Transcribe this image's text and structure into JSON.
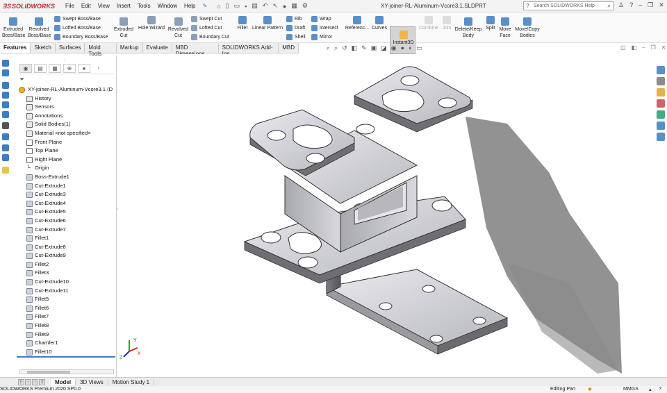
{
  "app": {
    "brand": "SOLIDWORKS",
    "filename": "XY-joiner-RL-Aluminum-Vcore3.1.SLDPRT"
  },
  "menus": [
    "File",
    "Edit",
    "View",
    "Insert",
    "Tools",
    "Window",
    "Help"
  ],
  "search": {
    "placeholder": "Search SOLIDWORKS Help"
  },
  "ribbon": {
    "extruded_boss": "Extruded\nBoss/Base",
    "revolved_boss": "Revolved\nBoss/Base",
    "swept_boss": "Swept Boss/Base",
    "lofted_boss": "Lofted Boss/Base",
    "boundary_boss": "Boundary Boss/Base",
    "extruded_cut": "Extruded\nCut",
    "hole_wizard": "Hole Wizard",
    "revolved_cut": "Revolved\nCut",
    "swept_cut": "Swept Cut",
    "lofted_cut": "Lofted Cut",
    "boundary_cut": "Boundary Cut",
    "fillet": "Fillet",
    "linear_pattern": "Linear Pattern",
    "rib": "Rib",
    "draft": "Draft",
    "shell": "Shell",
    "wrap": "Wrap",
    "intersect": "Intersect",
    "mirror": "Mirror",
    "reference": "Referenc...",
    "curves": "Curves",
    "instant3d": "Instant3D",
    "combine": "Combine",
    "join": "Join",
    "delete_keep": "Delete/Keep\nBody",
    "split": "Split",
    "move_face": "Move\nFace",
    "move_copy": "Move/Copy\nBodies"
  },
  "command_tabs": [
    "Features",
    "Sketch",
    "Surfaces",
    "Mold Tools",
    "Markup",
    "Evaluate",
    "MBD Dimensions",
    "SOLIDWORKS Add-Ins",
    "MBD"
  ],
  "tree": [
    {
      "label": "XY-joiner-RL-Aluminum-Vcore3.1  (D",
      "icon": "part",
      "exp": false,
      "indent": 0
    },
    {
      "label": "History",
      "icon": "folder",
      "exp": true,
      "indent": 1
    },
    {
      "label": "Sensors",
      "icon": "folder",
      "exp": false,
      "indent": 1
    },
    {
      "label": "Annotations",
      "icon": "folder",
      "exp": true,
      "indent": 1
    },
    {
      "label": "Solid Bodies(1)",
      "icon": "folder",
      "exp": true,
      "indent": 1
    },
    {
      "label": "Material <not specified>",
      "icon": "folder",
      "exp": false,
      "indent": 1
    },
    {
      "label": "Front Plane",
      "icon": "plane",
      "exp": false,
      "indent": 1
    },
    {
      "label": "Top Plane",
      "icon": "plane",
      "exp": false,
      "indent": 1
    },
    {
      "label": "Right Plane",
      "icon": "plane",
      "exp": false,
      "indent": 1
    },
    {
      "label": "Origin",
      "icon": "origin",
      "exp": false,
      "indent": 1
    },
    {
      "label": "Boss-Extrude1",
      "icon": "feat",
      "exp": true,
      "indent": 1
    },
    {
      "label": "Cut-Extrude1",
      "icon": "feat",
      "exp": true,
      "indent": 1
    },
    {
      "label": "Cut-Extrude3",
      "icon": "feat",
      "exp": true,
      "indent": 1
    },
    {
      "label": "Cut-Extrude4",
      "icon": "feat",
      "exp": true,
      "indent": 1
    },
    {
      "label": "Cut-Extrude5",
      "icon": "feat",
      "exp": true,
      "indent": 1
    },
    {
      "label": "Cut-Extrude6",
      "icon": "feat",
      "exp": true,
      "indent": 1
    },
    {
      "label": "Cut-Extrude7",
      "icon": "feat",
      "exp": true,
      "indent": 1
    },
    {
      "label": "Fillet1",
      "icon": "feat",
      "exp": false,
      "indent": 1
    },
    {
      "label": "Cut-Extrude8",
      "icon": "feat",
      "exp": true,
      "indent": 1
    },
    {
      "label": "Cut-Extrude9",
      "icon": "feat",
      "exp": true,
      "indent": 1
    },
    {
      "label": "Fillet2",
      "icon": "feat",
      "exp": false,
      "indent": 1
    },
    {
      "label": "Fillet3",
      "icon": "feat",
      "exp": false,
      "indent": 1
    },
    {
      "label": "Cut-Extrude10",
      "icon": "feat",
      "exp": true,
      "indent": 1
    },
    {
      "label": "Cut-Extrude11",
      "icon": "feat",
      "exp": true,
      "indent": 1
    },
    {
      "label": "Fillet5",
      "icon": "feat",
      "exp": false,
      "indent": 1
    },
    {
      "label": "Fillet6",
      "icon": "feat",
      "exp": false,
      "indent": 1
    },
    {
      "label": "Fillet7",
      "icon": "feat",
      "exp": false,
      "indent": 1
    },
    {
      "label": "Fillet8",
      "icon": "feat",
      "exp": false,
      "indent": 1
    },
    {
      "label": "Fillet9",
      "icon": "feat",
      "exp": false,
      "indent": 1
    },
    {
      "label": "Chamfer1",
      "icon": "feat",
      "exp": false,
      "indent": 1
    },
    {
      "label": "Fillet10",
      "icon": "feat",
      "exp": false,
      "indent": 1
    }
  ],
  "bottom_tabs": [
    "Model",
    "3D Views",
    "Motion Study 1"
  ],
  "status": {
    "product": "SOLIDWORKS Premium 2020 SP0.0",
    "mode": "Editing Part",
    "units": "MMGS"
  },
  "triad": {
    "x": "X",
    "y": "Y",
    "z": "Z"
  },
  "colors": {
    "brand_red": "#c1272d",
    "accent_blue": "#3c7dc4",
    "model_metal": "#c8c8cc"
  }
}
